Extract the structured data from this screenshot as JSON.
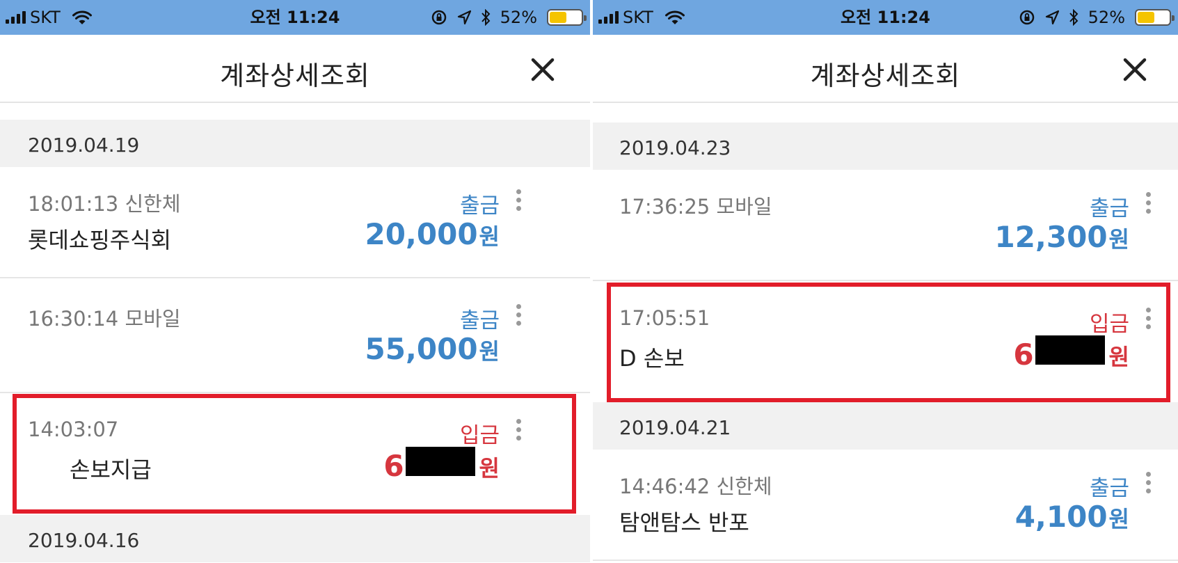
{
  "left_screen": {
    "status_bar": {
      "carrier": "SKT",
      "time": "오전 11:24",
      "battery_percent": "52%"
    },
    "header": {
      "title": "계좌상세조회",
      "close_icon": "close-icon"
    },
    "dates": [
      "2019.04.19",
      "2019.04.16"
    ],
    "transactions": [
      {
        "time": "18:01:13 신한체",
        "description": "롯데쇼핑주식회",
        "type": "출금",
        "amount": "20,000",
        "unit": "원"
      },
      {
        "time": "16:30:14 모바일",
        "description": "",
        "type": "출금",
        "amount": "55,000",
        "unit": "원"
      },
      {
        "time": "14:03:07",
        "description": "손보지급",
        "type": "입금",
        "amount_visible": "6",
        "amount_redacted": true,
        "unit": "원"
      }
    ]
  },
  "right_screen": {
    "status_bar": {
      "carrier": "SKT",
      "time": "오전 11:24",
      "battery_percent": "52%"
    },
    "header": {
      "title": "계좌상세조회",
      "close_icon": "close-icon"
    },
    "dates": [
      "2019.04.23",
      "2019.04.21"
    ],
    "transactions": [
      {
        "time": "17:36:25 모바일",
        "description": "",
        "type": "출금",
        "amount": "12,300",
        "unit": "원"
      },
      {
        "time": "17:05:51",
        "description": "D  손보",
        "type": "입금",
        "amount_visible": "6",
        "amount_redacted": true,
        "unit": "원"
      },
      {
        "time": "14:46:42 신한체",
        "description": "탐앤탐스 반포",
        "type": "출금",
        "amount": "4,100",
        "unit": "원"
      }
    ]
  },
  "colors": {
    "status_bar_bg": "#6fa6e0",
    "withdrawal": "#3d85c6",
    "deposit": "#d6363e",
    "highlight_box": "#e21d2a",
    "date_bar_bg": "#f1f1f1"
  },
  "icons": [
    "signal-bars-icon",
    "wifi-icon",
    "rotation-lock-icon",
    "location-arrow-icon",
    "bluetooth-icon",
    "battery-icon",
    "close-icon",
    "more-vertical-icon"
  ]
}
